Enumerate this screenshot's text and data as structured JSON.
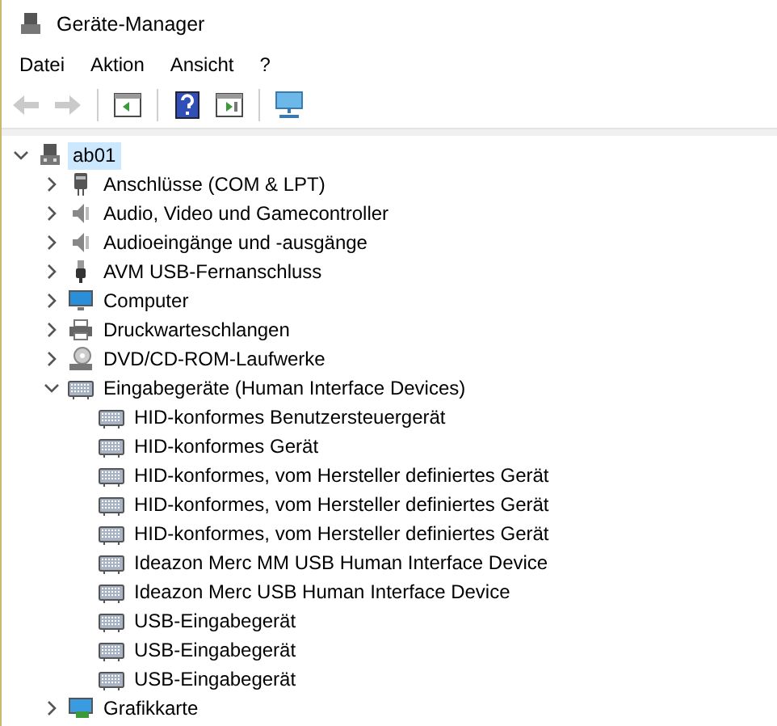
{
  "window": {
    "title": "Geräte-Manager"
  },
  "menu": [
    "Datei",
    "Aktion",
    "Ansicht",
    "?"
  ],
  "toolbar": [
    {
      "kind": "back",
      "disabled": true
    },
    {
      "kind": "forward",
      "disabled": true
    },
    {
      "kind": "separator"
    },
    {
      "kind": "properties",
      "disabled": false
    },
    {
      "kind": "separator"
    },
    {
      "kind": "help",
      "disabled": false
    },
    {
      "kind": "view",
      "disabled": false
    },
    {
      "kind": "separator"
    },
    {
      "kind": "scan",
      "disabled": false
    }
  ],
  "tree": [
    {
      "label": "ab01",
      "kind": "computer",
      "expanded": true,
      "selected": true,
      "children": [
        {
          "label": "Anschlüsse (COM & LPT)",
          "kind": "port",
          "expanded": false,
          "selected": false
        },
        {
          "label": "Audio, Video und Gamecontroller",
          "kind": "audio",
          "expanded": false,
          "selected": false
        },
        {
          "label": "Audioeingänge und -ausgänge",
          "kind": "audio",
          "expanded": false,
          "selected": false
        },
        {
          "label": "AVM USB-Fernanschluss",
          "kind": "usb",
          "expanded": false,
          "selected": false
        },
        {
          "label": "Computer",
          "kind": "monitor",
          "expanded": false,
          "selected": false
        },
        {
          "label": "Druckwarteschlangen",
          "kind": "printer",
          "expanded": false,
          "selected": false
        },
        {
          "label": "DVD/CD-ROM-Laufwerke",
          "kind": "disc",
          "expanded": false,
          "selected": false
        },
        {
          "label": "Eingabegeräte (Human Interface Devices)",
          "kind": "keyboard",
          "expanded": true,
          "selected": false,
          "children": [
            {
              "label": "HID-konformes Benutzersteuergerät",
              "kind": "keyboard",
              "selected": false
            },
            {
              "label": "HID-konformes Gerät",
              "kind": "keyboard",
              "selected": false
            },
            {
              "label": "HID-konformes, vom Hersteller definiertes Gerät",
              "kind": "keyboard",
              "selected": false
            },
            {
              "label": "HID-konformes, vom Hersteller definiertes Gerät",
              "kind": "keyboard",
              "selected": false
            },
            {
              "label": "HID-konformes, vom Hersteller definiertes Gerät",
              "kind": "keyboard",
              "selected": false
            },
            {
              "label": "Ideazon Merc MM USB Human Interface Device",
              "kind": "keyboard",
              "selected": false
            },
            {
              "label": "Ideazon Merc USB Human Interface Device",
              "kind": "keyboard",
              "selected": false
            },
            {
              "label": "USB-Eingabegerät",
              "kind": "keyboard",
              "selected": false
            },
            {
              "label": "USB-Eingabegerät",
              "kind": "keyboard",
              "selected": false
            },
            {
              "label": "USB-Eingabegerät",
              "kind": "keyboard",
              "selected": false
            }
          ]
        },
        {
          "label": "Grafikkarte",
          "kind": "display",
          "expanded": false,
          "selected": false
        }
      ]
    }
  ]
}
